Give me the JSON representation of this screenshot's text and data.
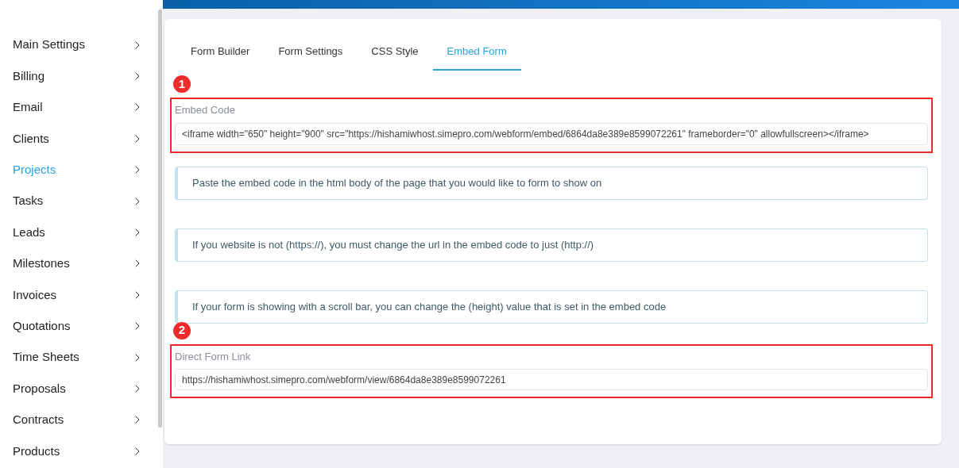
{
  "sidebar": {
    "items": [
      {
        "label": "Main Settings",
        "selected": false
      },
      {
        "label": "Billing",
        "selected": false
      },
      {
        "label": "Email",
        "selected": false
      },
      {
        "label": "Clients",
        "selected": false
      },
      {
        "label": "Projects",
        "selected": true
      },
      {
        "label": "Tasks",
        "selected": false
      },
      {
        "label": "Leads",
        "selected": false
      },
      {
        "label": "Milestones",
        "selected": false
      },
      {
        "label": "Invoices",
        "selected": false
      },
      {
        "label": "Quotations",
        "selected": false
      },
      {
        "label": "Time Sheets",
        "selected": false
      },
      {
        "label": "Proposals",
        "selected": false
      },
      {
        "label": "Contracts",
        "selected": false
      },
      {
        "label": "Products",
        "selected": false
      }
    ]
  },
  "tabs": [
    {
      "label": "Form Builder",
      "selected": false
    },
    {
      "label": "Form Settings",
      "selected": false
    },
    {
      "label": "CSS Style",
      "selected": false
    },
    {
      "label": "Embed Form",
      "selected": true
    }
  ],
  "embed_code": {
    "marker": "1",
    "label": "Embed Code",
    "value": "<iframe width=\"650\" height=\"900\" src=\"https://hishamiwhost.simepro.com/webform/embed/6864da8e389e8599072261\" frameborder=\"0\" allowfullscreen></iframe>"
  },
  "notes": [
    "Paste the embed code in the html body of the page that you would like to form to show on",
    "If you website is not (https://), you must change the url in the embed code to just (http://)",
    "If your form is showing with a scroll bar, you can change the (height) value that is set in the embed code"
  ],
  "direct_link": {
    "marker": "2",
    "label": "Direct Form Link",
    "value": "https://hishamiwhost.simepro.com/webform/view/6864da8e389e8599072261"
  }
}
